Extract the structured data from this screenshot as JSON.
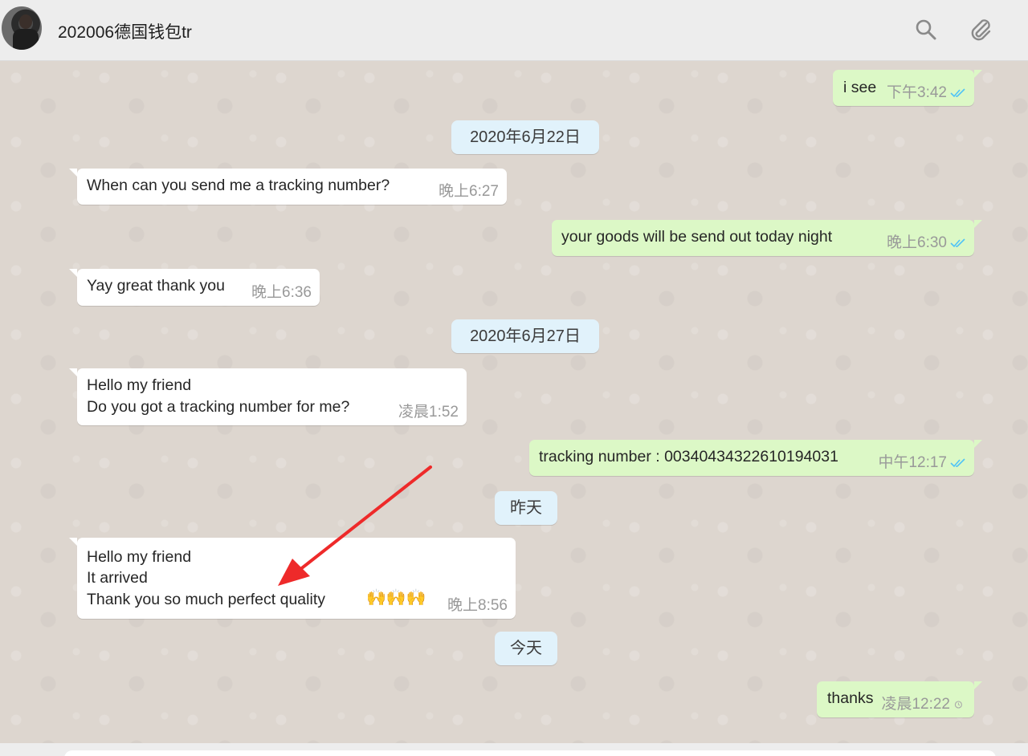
{
  "header": {
    "contact_name": "202006德国钱包tr",
    "icons": [
      "search-icon",
      "paperclip-icon"
    ]
  },
  "messages": [
    {
      "type": "out",
      "text": "i see",
      "time": "下午3:42",
      "status": "read"
    },
    {
      "type": "date",
      "text": "2020年6月22日"
    },
    {
      "type": "in",
      "text": "When can you send me a tracking number?",
      "time": "晚上6:27"
    },
    {
      "type": "out",
      "text": "your goods will be send out today night",
      "time": "晚上6:30",
      "status": "read"
    },
    {
      "type": "in",
      "text": "Yay great thank you",
      "time": "晚上6:36"
    },
    {
      "type": "date",
      "text": "2020年6月27日"
    },
    {
      "type": "in",
      "lines": [
        "Hello my friend",
        "Do you got a tracking number for me?"
      ],
      "time": "凌晨1:52"
    },
    {
      "type": "out",
      "text": "tracking number : 00340434322610194031",
      "time": "中午12:17",
      "status": "read"
    },
    {
      "type": "date",
      "text": "昨天"
    },
    {
      "type": "in",
      "lines": [
        "Hello my friend",
        "It arrived",
        "Thank you so much perfect quality"
      ],
      "emoji": "🙌🙌🙌",
      "time": "晚上8:56"
    },
    {
      "type": "date",
      "text": "今天"
    },
    {
      "type": "out",
      "text": "thanks",
      "time": "凌晨12:22",
      "status": "pending"
    }
  ],
  "colors": {
    "chat_bg": "#ddd6cf",
    "outgoing_bubble": "#dcf8c6",
    "incoming_bubble": "#ffffff",
    "date_chip": "#e1f2fb",
    "read_tick": "#4fc3f7",
    "annotation_arrow": "#ee2a2a"
  }
}
